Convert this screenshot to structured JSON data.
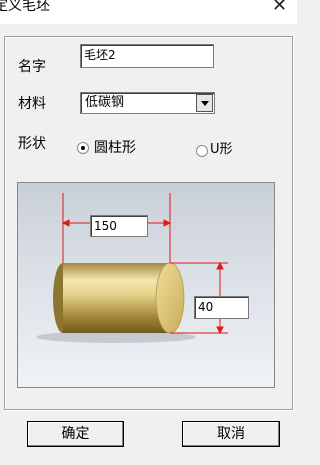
{
  "window": {
    "title": "定义毛坯",
    "close_glyph": "✕"
  },
  "form": {
    "name_label": "名字",
    "name_value": "毛坯2",
    "material_label": "材料",
    "material_value": "低碳钢",
    "shape_label": "形状",
    "shape_options": [
      {
        "label": "圆柱形",
        "selected": true
      },
      {
        "label": "U形",
        "selected": false
      }
    ]
  },
  "preview": {
    "length_value": "150",
    "diameter_value": "40",
    "colors": {
      "dimension_line": "#e01818",
      "cylinder": "#d8c47a"
    }
  },
  "buttons": {
    "ok_label": "确定",
    "cancel_label": "取消"
  }
}
